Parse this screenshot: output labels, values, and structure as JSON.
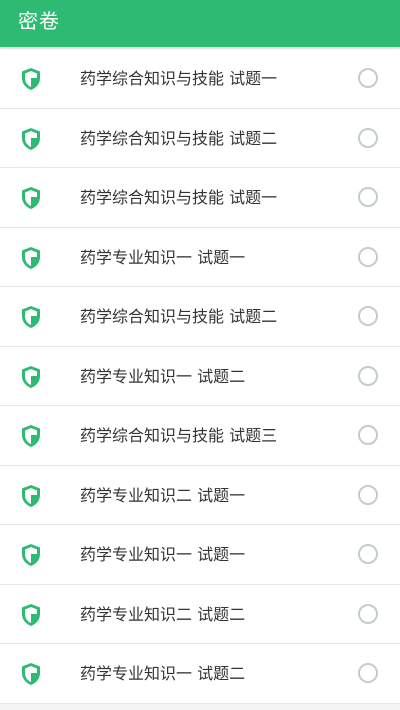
{
  "header": {
    "title": "密卷",
    "background": "#2fba73"
  },
  "list": {
    "icon": "shield-check-icon",
    "accent": "#2fba73",
    "items": [
      {
        "label": "药学综合知识与技能 试题一",
        "selected": false
      },
      {
        "label": "药学综合知识与技能 试题二",
        "selected": false
      },
      {
        "label": "药学综合知识与技能 试题一",
        "selected": false
      },
      {
        "label": "药学专业知识一 试题一",
        "selected": false
      },
      {
        "label": "药学综合知识与技能 试题二",
        "selected": false
      },
      {
        "label": "药学专业知识一 试题二",
        "selected": false
      },
      {
        "label": "药学综合知识与技能 试题三",
        "selected": false
      },
      {
        "label": "药学专业知识二 试题一",
        "selected": false
      },
      {
        "label": "药学专业知识一 试题一",
        "selected": false
      },
      {
        "label": "药学专业知识二 试题二",
        "selected": false
      },
      {
        "label": "药学专业知识一 试题二",
        "selected": false
      }
    ]
  }
}
